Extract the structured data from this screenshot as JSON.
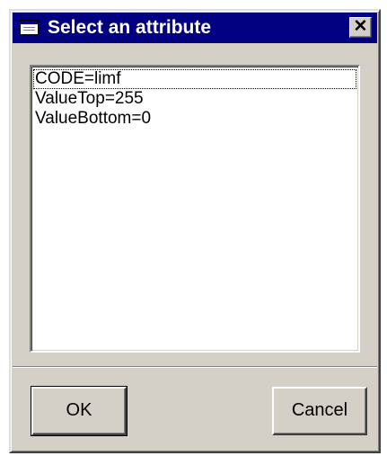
{
  "window": {
    "title": "Select an attribute",
    "close_glyph": "✕",
    "icon": "window-icon"
  },
  "attributes_list": {
    "items": [
      {
        "label": "CODE=limf",
        "focused": true
      },
      {
        "label": "ValueTop=255",
        "focused": false
      },
      {
        "label": "ValueBottom=0",
        "focused": false
      }
    ]
  },
  "buttons": {
    "ok_label": "OK",
    "cancel_label": "Cancel"
  },
  "colors": {
    "titlebar": "#000080",
    "face": "#d4d0c8",
    "list_background": "#ffffff"
  }
}
